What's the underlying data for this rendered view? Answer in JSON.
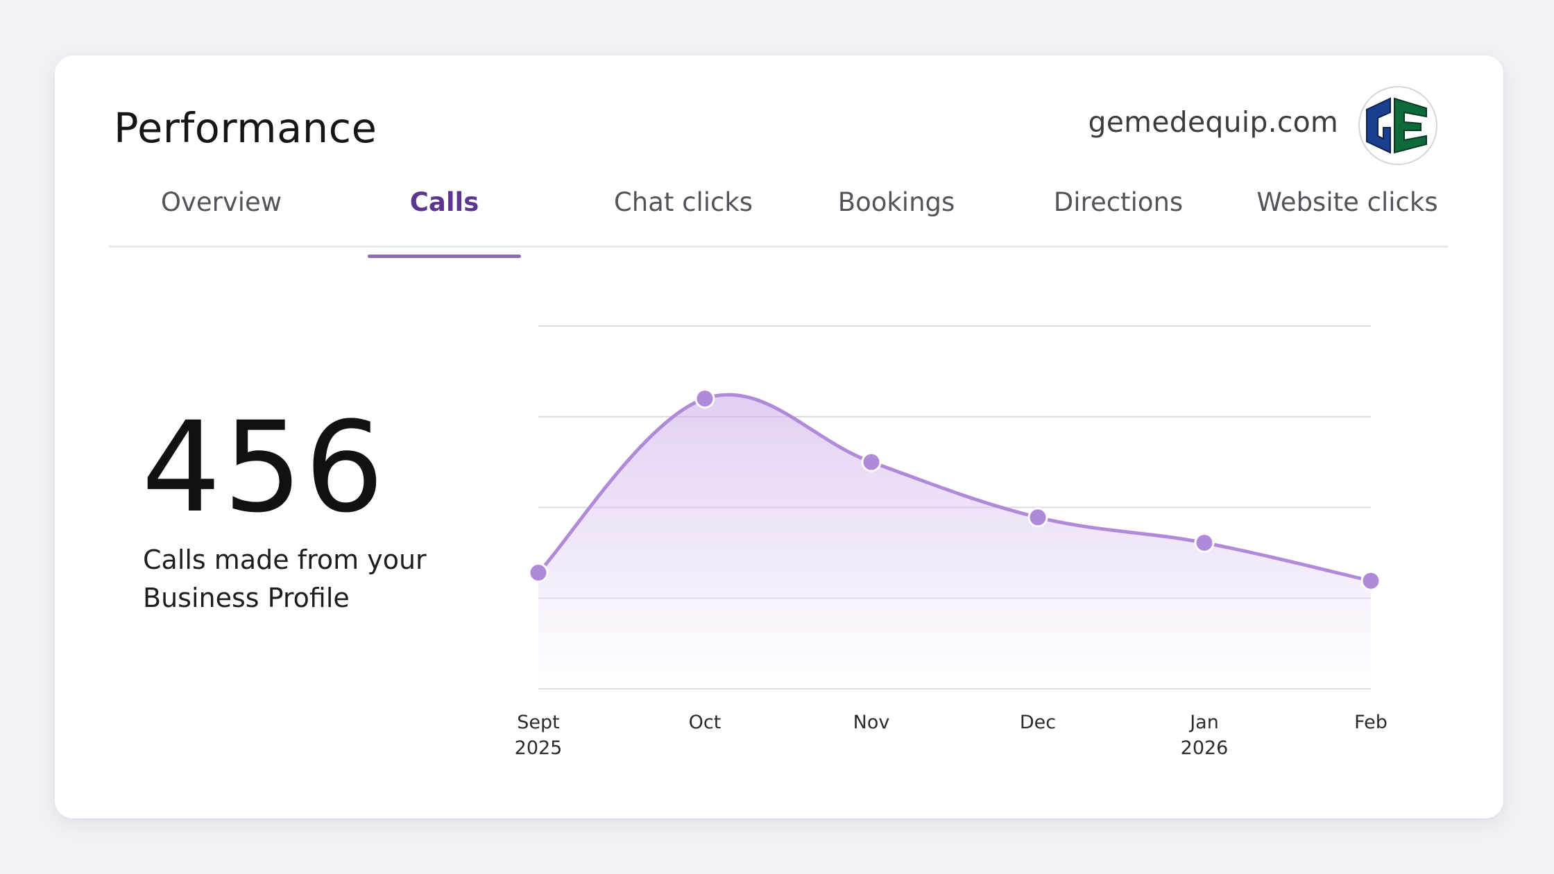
{
  "header": {
    "title": "Performance",
    "domain": "gemedequip.com",
    "logo_icon": "ge-logo-icon"
  },
  "tabs": [
    {
      "label": "Overview",
      "active": false
    },
    {
      "label": "Calls",
      "active": true
    },
    {
      "label": "Chat clicks",
      "active": false
    },
    {
      "label": "Bookings",
      "active": false
    },
    {
      "label": "Directions",
      "active": false
    },
    {
      "label": "Website clicks",
      "active": false
    }
  ],
  "metric": {
    "value": "456",
    "caption_line1": "Calls made from your",
    "caption_line2": "Business Profile"
  },
  "colors": {
    "accent": "#5c3590",
    "line": "#b08ad8",
    "point": "#b08ad8",
    "logo_blue": "#1a3f8f",
    "logo_green": "#0f6a3a"
  },
  "chart_data": {
    "type": "area",
    "x": [
      {
        "month": "Sept",
        "year": "2025"
      },
      {
        "month": "Oct",
        "year": ""
      },
      {
        "month": "Nov",
        "year": ""
      },
      {
        "month": "Dec",
        "year": ""
      },
      {
        "month": "Jan",
        "year": "2026"
      },
      {
        "month": "Feb",
        "year": ""
      }
    ],
    "values": [
      128,
      320,
      250,
      189,
      161,
      119
    ],
    "ylim": [
      0,
      400
    ],
    "gridlines": 5,
    "grid": true,
    "legend": "none"
  }
}
